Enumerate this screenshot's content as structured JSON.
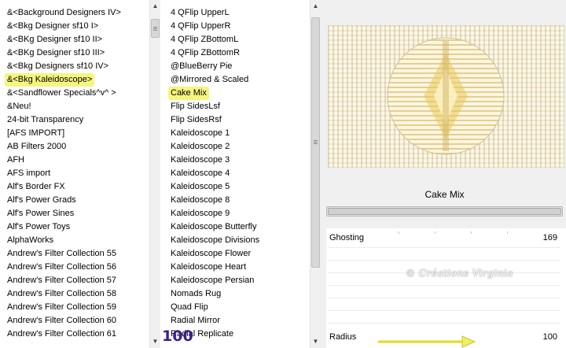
{
  "left_list": {
    "items": [
      "&<Background Designers IV>",
      "&<Bkg Designer sf10 I>",
      "&<BKg Designer sf10 II>",
      "&<BKg Designer sf10 III>",
      "&<Bkg Designers sf10 IV>",
      "&<Bkg Kaleidoscope>",
      "&<Sandflower Specials^v^ >",
      "&Neu!",
      "24-bit Transparency",
      "[AFS IMPORT]",
      "AB Filters 2000",
      "AFH",
      "AFS import",
      "Alf's Border FX",
      "Alf's Power Grads",
      "Alf's Power Sines",
      "Alf's Power Toys",
      "AlphaWorks",
      "Andrew's Filter Collection 55",
      "Andrew's Filter Collection 56",
      "Andrew's Filter Collection 57",
      "Andrew's Filter Collection 58",
      "Andrew's Filter Collection 59",
      "Andrew's Filter Collection 60",
      "Andrew's Filter Collection 61"
    ],
    "selected_index": 5
  },
  "mid_list": {
    "items": [
      "4 QFlip UpperL",
      "4 QFlip UpperR",
      "4 QFlip ZBottomL",
      "4 QFlip ZBottomR",
      "@BlueBerry Pie",
      "@Mirrored & Scaled",
      "Cake Mix",
      "Flip SidesLsf",
      "Flip SidesRsf",
      "Kaleidoscope 1",
      "Kaleidoscope 2",
      "Kaleidoscope 3",
      "Kaleidoscope 4",
      "Kaleidoscope 5",
      "Kaleidoscope 8",
      "Kaleidoscope 9",
      "Kaleidoscope Butterfly",
      "Kaleidoscope Divisions",
      "Kaleidoscope Flower",
      "Kaleidoscope Heart",
      "Kaleidoscope Persian",
      "Nomads Rug",
      "Quad Flip",
      "Radial Mirror",
      "Radial Replicate"
    ],
    "selected_index": 6
  },
  "preview": {
    "filter_name": "Cake Mix",
    "colors": {
      "light": "#fbf7ea",
      "tan": "#d8c79a",
      "gold": "#e9c85a",
      "grey": "#b7b2a6"
    }
  },
  "params": {
    "ghosting": {
      "label": "Ghosting",
      "value": "169"
    },
    "radius": {
      "label": "Radius",
      "value": "100",
      "highlight_value": "100"
    }
  },
  "watermark": "© Créations Virginia",
  "colors": {
    "selection": "#f5f580",
    "arrow": "#f0f060",
    "value_purple": "#3a1f8a"
  }
}
